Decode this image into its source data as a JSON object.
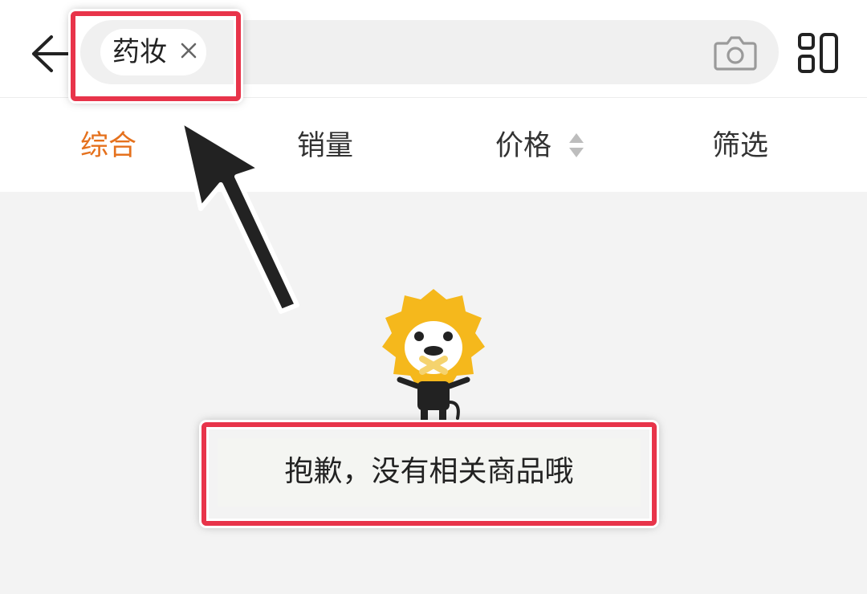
{
  "search": {
    "chip_label": "药妆",
    "close_symbol": "×"
  },
  "tabs": [
    {
      "label": "综合",
      "active": true
    },
    {
      "label": "销量",
      "active": false
    },
    {
      "label": "价格",
      "active": false
    },
    {
      "label": "筛选",
      "active": false
    }
  ],
  "empty_state": {
    "message": "抱歉，没有相关商品哦"
  },
  "icons": {
    "back": "back-arrow-icon",
    "camera": "camera-icon",
    "grid": "grid-icon",
    "sort": "sort-icon",
    "mascot": "lion-mascot"
  },
  "colors": {
    "accent": "#e5711d",
    "highlight": "#e8344a",
    "mascot_yellow": "#f5b81c"
  }
}
